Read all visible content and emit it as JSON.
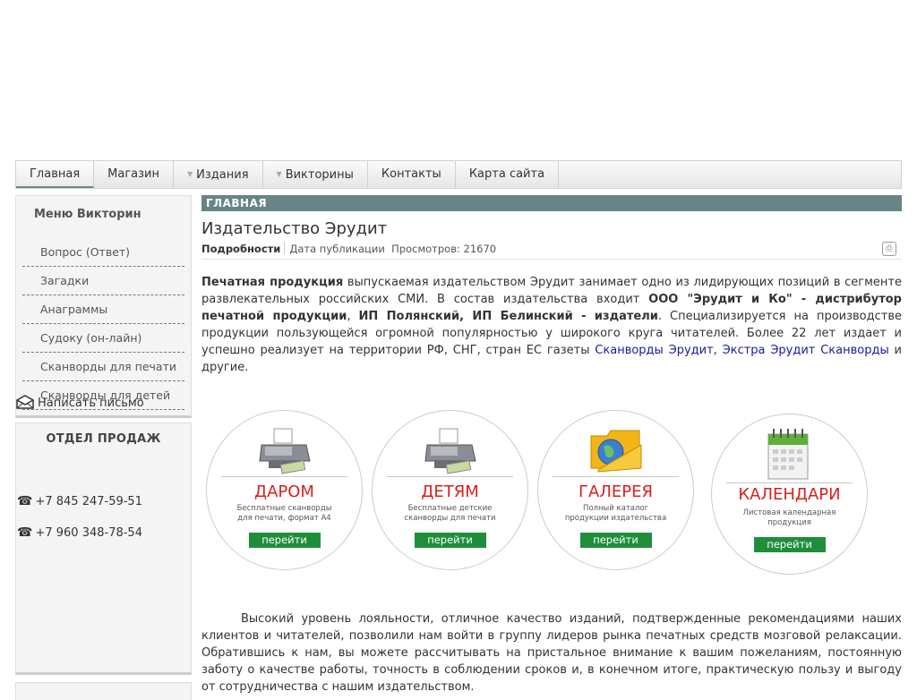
{
  "nav": {
    "items": [
      {
        "label": "Главная"
      },
      {
        "label": "Магазин"
      },
      {
        "label": "Издания"
      },
      {
        "label": "Викторины"
      },
      {
        "label": "Контакты"
      },
      {
        "label": "Карта сайта"
      }
    ]
  },
  "sidebar": {
    "menu_title": "Меню Викторин",
    "menu_items": [
      {
        "label": "Вопрос (Ответ)"
      },
      {
        "label": "Загадки"
      },
      {
        "label": "Анаграммы"
      },
      {
        "label": "Судоку (он-лайн)"
      },
      {
        "label": "Сканворды для печати"
      },
      {
        "label": "Сканворды для детей"
      }
    ],
    "sales_title": "ОТДЕЛ ПРОДАЖ",
    "phone1": "+7 845 247-59-51",
    "phone2": "+7 960 348-78-54",
    "mail_label": "Написать письмо"
  },
  "main": {
    "section_label": "ГЛАВНАЯ",
    "title": "Издательство Эрудит",
    "meta_details": "Подробности",
    "meta_date_label": "Дата публикации",
    "meta_views": "Просмотров: 21670",
    "intro": {
      "b1": "Печатная продукция",
      "t1": " выпускаемая издательством Эрудит занимает одно из лидирующих позиций в сегменте развлекательных российских СМИ. В состав издательства входит ",
      "b2": "ООО \"Эрудит и Ко\" - дистрибутор печатной продукции",
      "t2": ", ",
      "b3": "ИП Полянский,  ИП Белинский - издатели",
      "t3": ". Специализируется на производстве продукции пользующейся огромной популярностью у широкого круга читателей. Более 22 лет издает и успешно реализует на территории РФ, СНГ, стран ЕС газеты ",
      "link1": "Сканворды Эрудит",
      "t4": ", ",
      "link2": "Экстра Эрудит Сканворды",
      "t5": " и ",
      "t6": "другие",
      "t7": "."
    },
    "cards": [
      {
        "title": "ДАРОМ",
        "desc1": "Бесплатные сканворды",
        "desc2": "для печати, формат А4",
        "button": "перейти",
        "icon": "printer-icon"
      },
      {
        "title": "ДЕТЯМ",
        "desc1": "Бесплатные детские",
        "desc2": "сканворды для печати",
        "button": "перейти",
        "icon": "printer-icon"
      },
      {
        "title": "ГАЛЕРЕЯ",
        "desc1": "Полный каталог",
        "desc2": "продукции издательства",
        "button": "перейти",
        "icon": "folder-globe-icon"
      },
      {
        "title": "КАЛЕНДАРИ",
        "desc1": "Листовая календарная",
        "desc2": "продукция",
        "button": "перейти",
        "icon": "calendar-icon"
      }
    ],
    "body_text": "Высокий уровень лояльности, отличное качество изданий, подтвержденные рекомендациями наших клиентов и читателей, позволили нам войти в группу лидеров рынка печатных средств мозговой релаксации. Обратившись к нам, вы можете рассчитывать на пристальное внимание к вашим пожеланиям, постоянную заботу о качестве работы, точность в соблюдении сроков и, в конечном итоге, практическую пользу и выгоду от сотрудничества с нашим издательством."
  },
  "colors": {
    "section_bar": "#678586",
    "card_title": "#d8201e",
    "card_button": "#1f8e3b",
    "link": "#1a1a99"
  }
}
